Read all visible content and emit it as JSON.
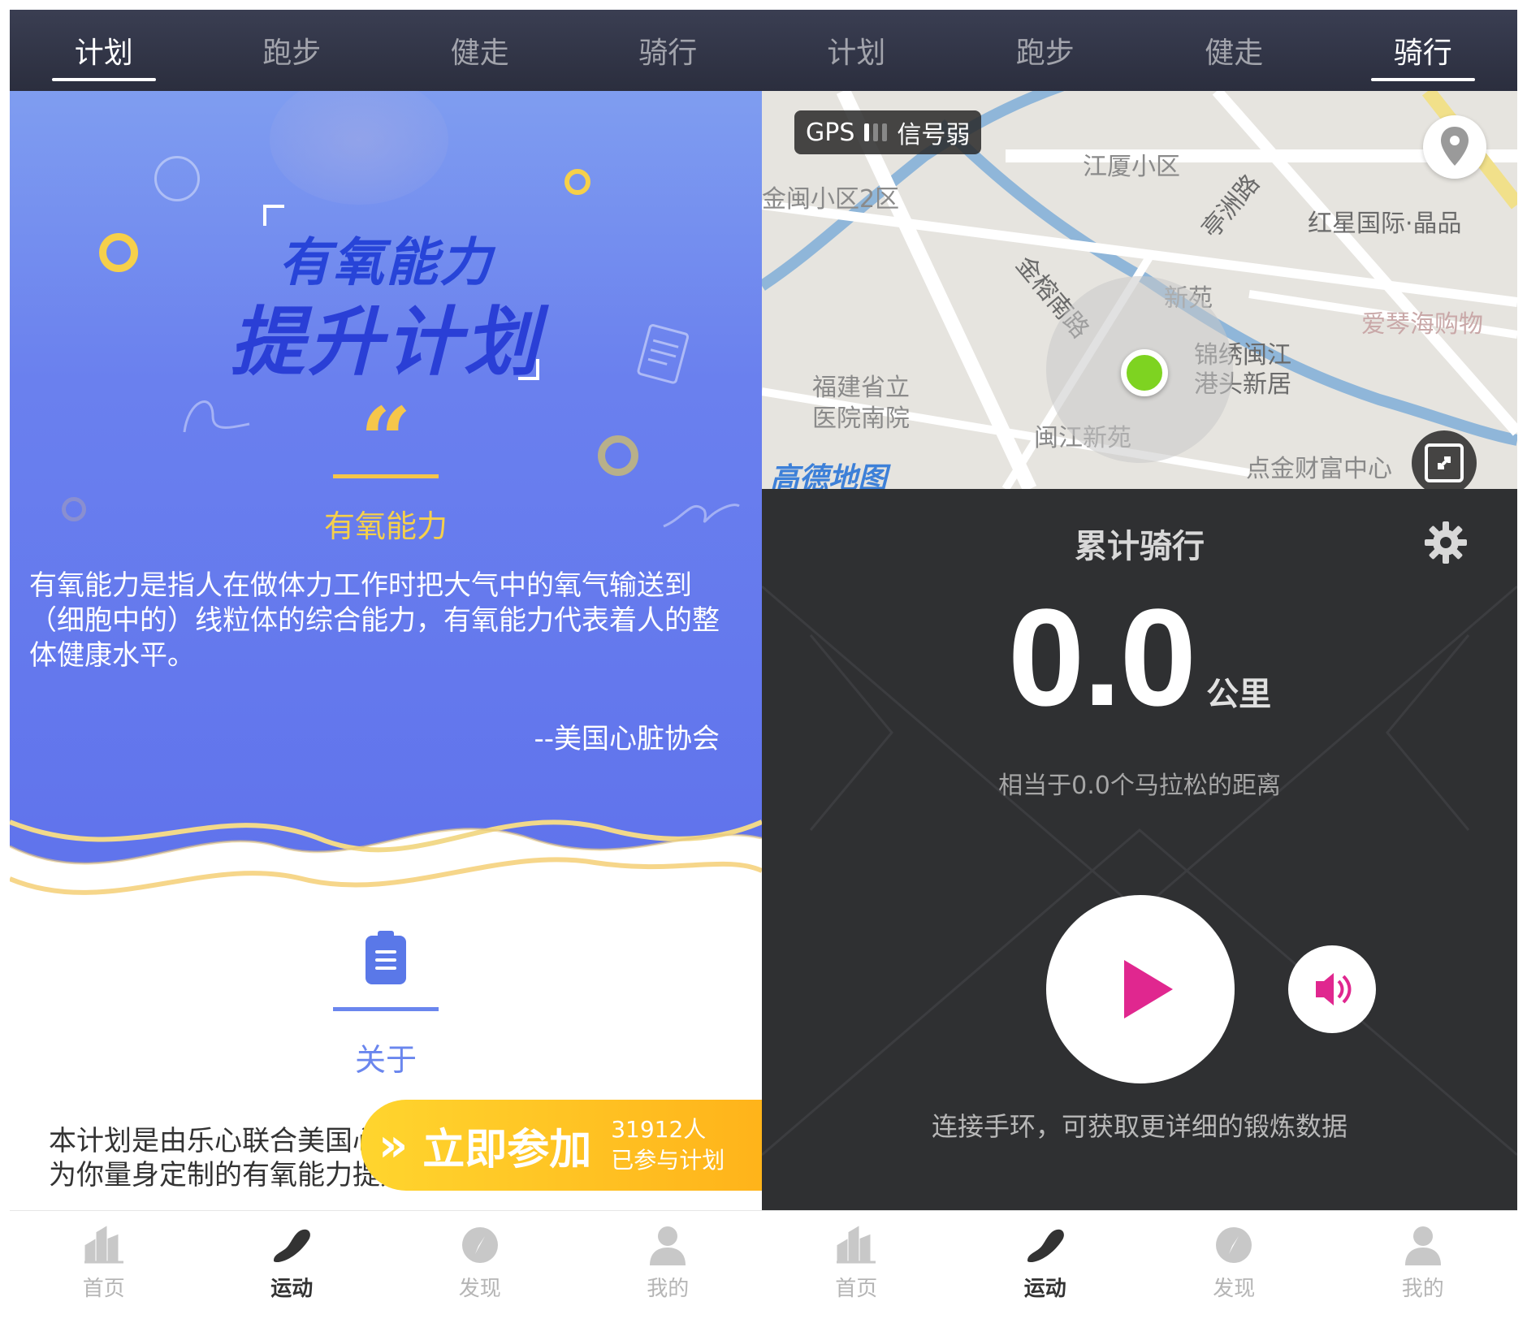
{
  "left": {
    "tabs": [
      {
        "label": "计划",
        "active": true
      },
      {
        "label": "跑步",
        "active": false
      },
      {
        "label": "健走",
        "active": false
      },
      {
        "label": "骑行",
        "active": false
      }
    ],
    "poster": {
      "title_line1": "有氧能力",
      "title_line2": "提升计划",
      "quote_mark": "“",
      "section_title": "有氧能力",
      "description": "有氧能力是指人在做体力工作时把大气中的氧气输送到（细胞中的）线粒体的综合能力，有氧能力代表着人的整体健康水平。",
      "attribution": "--美国心脏协会"
    },
    "about": {
      "title": "关于",
      "text": "本计划是由乐心联合美国心脏协会根据你的身体数据，为你量身定制的有氧能力提升计划，提高你健康水平。"
    },
    "join": {
      "label": "立即参加",
      "count": "31912人",
      "count_sub": "已参与计划"
    },
    "bottom_nav": [
      {
        "label": "首页",
        "icon": "chart-bars-icon",
        "active": false
      },
      {
        "label": "运动",
        "icon": "shoe-icon",
        "active": true
      },
      {
        "label": "发现",
        "icon": "compass-icon",
        "active": false
      },
      {
        "label": "我的",
        "icon": "person-icon",
        "active": false
      }
    ]
  },
  "right": {
    "tabs": [
      {
        "label": "计划",
        "active": false
      },
      {
        "label": "跑步",
        "active": false
      },
      {
        "label": "健走",
        "active": false
      },
      {
        "label": "骑行",
        "active": true
      }
    ],
    "map": {
      "gps_label": "GPS",
      "gps_status": "信号弱",
      "provider": "高德地图",
      "labels": [
        "江厦小区",
        "金闽小区2区",
        "红星国际·晶品",
        "金榕南路",
        "亭洲路",
        "新苑",
        "锦绣闽江",
        "港头新居",
        "爱琴海购物",
        "福建省立",
        "医院南院",
        "闽江新苑",
        "点金财富中心"
      ]
    },
    "ride": {
      "title": "累计骑行",
      "distance": "0.0",
      "unit": "公里",
      "equivalent": "相当于0.0个马拉松的距离",
      "band_tip": "连接手环，可获取更详细的锻炼数据"
    },
    "bottom_nav": [
      {
        "label": "首页",
        "icon": "chart-bars-icon",
        "active": false
      },
      {
        "label": "运动",
        "icon": "shoe-icon",
        "active": true
      },
      {
        "label": "发现",
        "icon": "compass-icon",
        "active": false
      },
      {
        "label": "我的",
        "icon": "person-icon",
        "active": false
      }
    ]
  },
  "colors": {
    "hero_blue": "#6a80ee",
    "accent_yellow": "#f6c64a",
    "join_orange": "#ffb31a",
    "map_dot_green": "#7ed321",
    "play_magenta": "#e0278f",
    "ride_bg": "#2f3032"
  }
}
